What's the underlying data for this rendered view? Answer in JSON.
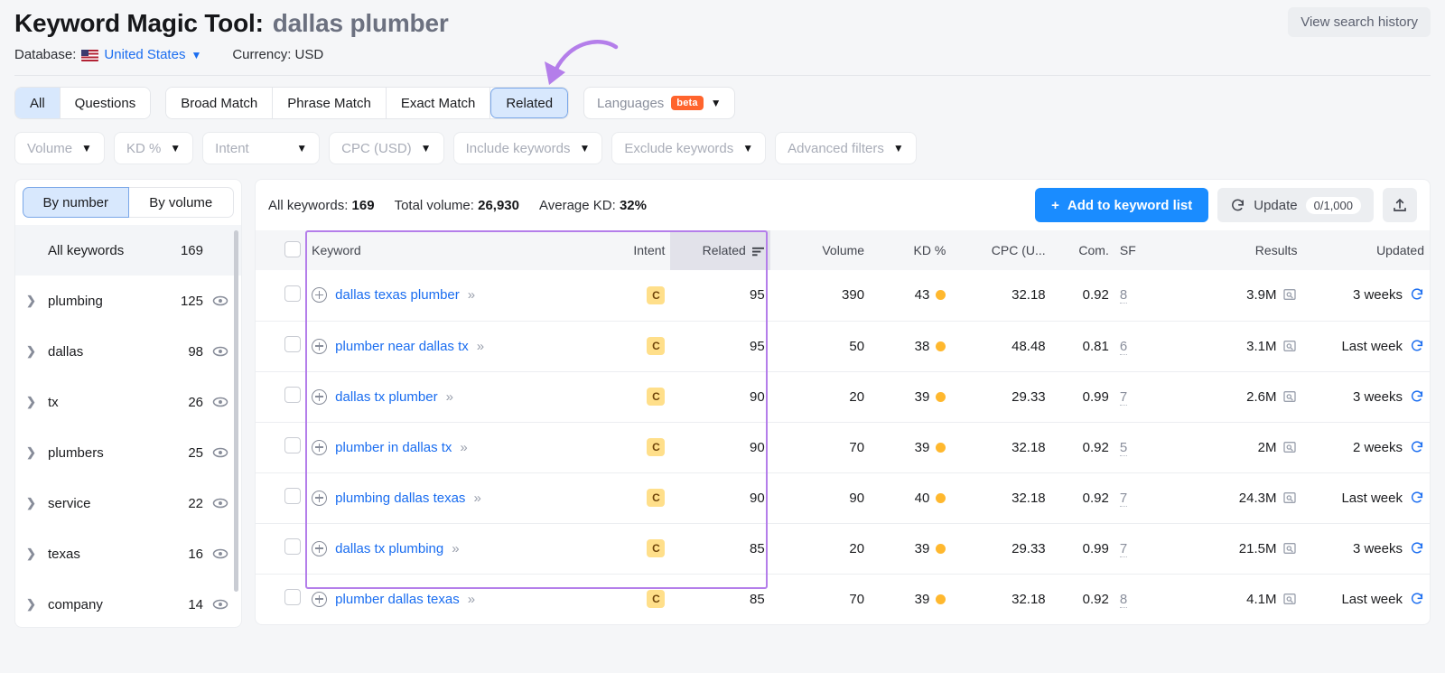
{
  "header": {
    "tool_name": "Keyword Magic Tool:",
    "query": "dallas plumber",
    "view_history_label": "View search history",
    "database_label": "Database:",
    "database_value": "United States",
    "currency_label": "Currency: USD",
    "flag_icon": "us-flag-icon"
  },
  "tabs": {
    "items": [
      {
        "label": "All",
        "state": "active"
      },
      {
        "label": "Questions",
        "state": "normal"
      },
      {
        "label": "Broad Match",
        "state": "normal"
      },
      {
        "label": "Phrase Match",
        "state": "normal"
      },
      {
        "label": "Exact Match",
        "state": "normal"
      },
      {
        "label": "Related",
        "state": "highlight"
      }
    ],
    "languages_label": "Languages",
    "languages_badge": "beta"
  },
  "filters": [
    {
      "label": "Volume"
    },
    {
      "label": "KD %"
    },
    {
      "label": "Intent"
    },
    {
      "label": "CPC (USD)"
    },
    {
      "label": "Include keywords"
    },
    {
      "label": "Exclude keywords"
    },
    {
      "label": "Advanced filters"
    }
  ],
  "sidebar": {
    "toggle": {
      "by_number": "By number",
      "by_volume": "By volume",
      "selected": "By number"
    },
    "all_keywords_label": "All keywords",
    "all_keywords_count": "169",
    "groups": [
      {
        "name": "plumbing",
        "count": "125"
      },
      {
        "name": "dallas",
        "count": "98"
      },
      {
        "name": "tx",
        "count": "26"
      },
      {
        "name": "plumbers",
        "count": "25"
      },
      {
        "name": "service",
        "count": "22"
      },
      {
        "name": "texas",
        "count": "16"
      },
      {
        "name": "company",
        "count": "14"
      }
    ]
  },
  "toolbar": {
    "all_keywords_label": "All keywords:",
    "all_keywords_value": "169",
    "total_volume_label": "Total volume:",
    "total_volume_value": "26,930",
    "average_kd_label": "Average KD:",
    "average_kd_value": "32%",
    "add_to_list_label": "Add to keyword list",
    "update_label": "Update",
    "update_quota": "0/1,000",
    "export_icon": "export-upload-icon"
  },
  "table": {
    "columns": [
      "Keyword",
      "Intent",
      "Related",
      "Volume",
      "KD %",
      "CPC (U...",
      "Com.",
      "SF",
      "Results",
      "Updated"
    ],
    "sorted_column": "Related",
    "rows": [
      {
        "keyword": "dallas texas plumber",
        "intent": "C",
        "related": "95",
        "volume": "390",
        "kd": "43",
        "cpc": "32.18",
        "com": "0.92",
        "sf": "8",
        "results": "3.9M",
        "updated": "3 weeks"
      },
      {
        "keyword": "plumber near dallas tx",
        "intent": "C",
        "related": "95",
        "volume": "50",
        "kd": "38",
        "cpc": "48.48",
        "com": "0.81",
        "sf": "6",
        "results": "3.1M",
        "updated": "Last week"
      },
      {
        "keyword": "dallas tx plumber",
        "intent": "C",
        "related": "90",
        "volume": "20",
        "kd": "39",
        "cpc": "29.33",
        "com": "0.99",
        "sf": "7",
        "results": "2.6M",
        "updated": "3 weeks"
      },
      {
        "keyword": "plumber in dallas tx",
        "intent": "C",
        "related": "90",
        "volume": "70",
        "kd": "39",
        "cpc": "32.18",
        "com": "0.92",
        "sf": "5",
        "results": "2M",
        "updated": "2 weeks"
      },
      {
        "keyword": "plumbing dallas texas",
        "intent": "C",
        "related": "90",
        "volume": "90",
        "kd": "40",
        "cpc": "32.18",
        "com": "0.92",
        "sf": "7",
        "results": "24.3M",
        "updated": "Last week"
      },
      {
        "keyword": "dallas tx plumbing",
        "intent": "C",
        "related": "85",
        "volume": "20",
        "kd": "39",
        "cpc": "29.33",
        "com": "0.99",
        "sf": "7",
        "results": "21.5M",
        "updated": "3 weeks"
      },
      {
        "keyword": "plumber dallas texas",
        "intent": "C",
        "related": "85",
        "volume": "70",
        "kd": "39",
        "cpc": "32.18",
        "com": "0.92",
        "sf": "8",
        "results": "4.1M",
        "updated": "Last week"
      }
    ]
  },
  "annotations": {
    "arrow_color": "#b47eea",
    "highlight_color": "#b47eea",
    "accent_blue": "#1a8cff",
    "link_blue": "#1a6df0",
    "kd_dot_color": "#ffb82e",
    "intent_badge_color": "#ffdf8a"
  }
}
